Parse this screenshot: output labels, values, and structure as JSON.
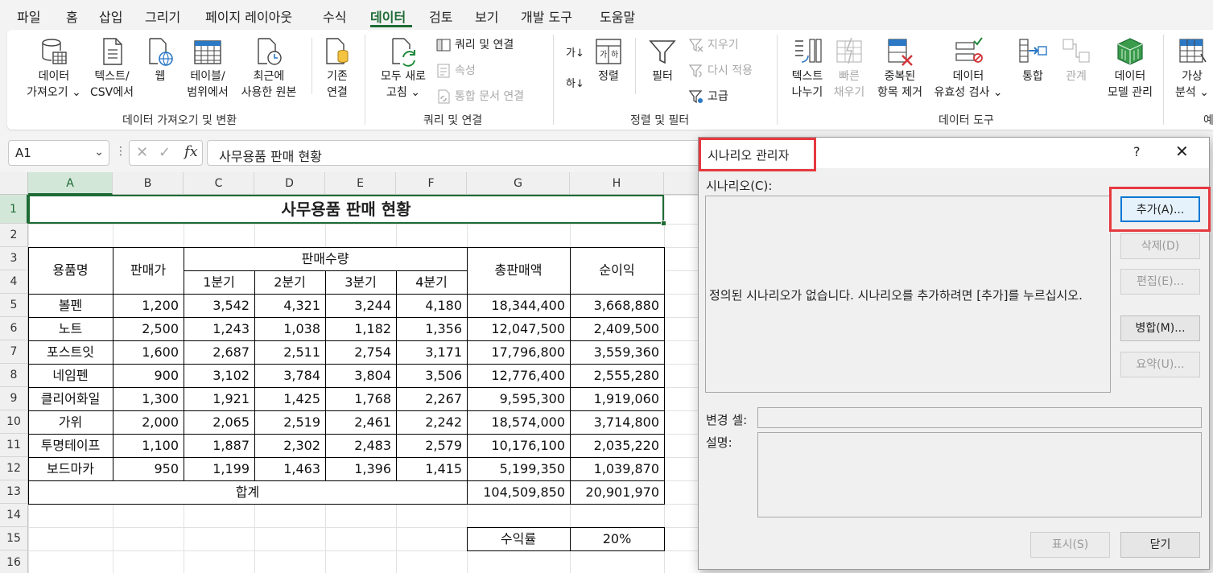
{
  "menu": {
    "items": [
      "파일",
      "홈",
      "삽입",
      "그리기",
      "페이지 레이아웃",
      "수식",
      "데이터",
      "검토",
      "보기",
      "개발 도구",
      "도움말"
    ],
    "active": "데이터"
  },
  "ribbon": {
    "get_data": {
      "line1": "데이터",
      "line2": "가져오기 ⌄"
    },
    "text_csv": {
      "line1": "텍스트/",
      "line2": "CSV에서"
    },
    "web": {
      "line1": "웹"
    },
    "from_table": {
      "line1": "테이블/",
      "line2": "범위에서"
    },
    "recent_sources": {
      "line1": "최근에",
      "line2": "사용한 원본"
    },
    "existing_conn": {
      "line1": "기존",
      "line2": "연결"
    },
    "group_get_transform": "데이터 가져오기 및 변환",
    "refresh_all": {
      "line1": "모두 새로",
      "line2": "고침 ⌄"
    },
    "queries_connections": "쿼리 및 연결",
    "properties": "속성",
    "edit_links": "통합 문서 연결",
    "group_queries": "쿼리 및 연결",
    "sort_asc": "가↓",
    "sort_desc": "하↓",
    "sort": {
      "line1": "정렬"
    },
    "filter": {
      "line1": "필터"
    },
    "clear": "지우기",
    "reapply": "다시 적용",
    "advanced": "고급",
    "group_sort_filter": "정렬 및 필터",
    "text_to_columns": {
      "line1": "텍스트",
      "line2": "나누기"
    },
    "flash_fill": {
      "line1": "빠른",
      "line2": "채우기"
    },
    "remove_duplicates": {
      "line1": "중복된",
      "line2": "항목 제거"
    },
    "data_validation": {
      "line1": "데이터",
      "line2": "유효성 검사 ⌄"
    },
    "consolidate": {
      "line1": "통합"
    },
    "relationships": {
      "line1": "관계"
    },
    "data_model": {
      "line1": "데이터",
      "line2": "모델 관리"
    },
    "group_data_tools": "데이터 도구",
    "what_if": {
      "line1": "가상",
      "line2": "분석 ⌄"
    },
    "group_forecast_partial": "예"
  },
  "formula_bar": {
    "name_box": "A1",
    "fx": "fx",
    "formula": "사무용품 판매 현황"
  },
  "sheet": {
    "columns": [
      "A",
      "B",
      "C",
      "D",
      "E",
      "F",
      "G",
      "H"
    ],
    "rows": [
      "1",
      "2",
      "3",
      "4",
      "5",
      "6",
      "7",
      "8",
      "9",
      "10",
      "11",
      "12",
      "13",
      "14",
      "15",
      "16"
    ],
    "title": "사무용품 판매 현황",
    "headers": {
      "item": "용품명",
      "price": "판매가",
      "qty": "판매수량",
      "q1": "1분기",
      "q2": "2분기",
      "q3": "3분기",
      "q4": "4분기",
      "total_sales": "총판매액",
      "net_profit": "순이익"
    },
    "data": [
      [
        "볼펜",
        "1,200",
        "3,542",
        "4,321",
        "3,244",
        "4,180",
        "18,344,400",
        "3,668,880"
      ],
      [
        "노트",
        "2,500",
        "1,243",
        "1,038",
        "1,182",
        "1,356",
        "12,047,500",
        "2,409,500"
      ],
      [
        "포스트잇",
        "1,600",
        "2,687",
        "2,511",
        "2,754",
        "3,171",
        "17,796,800",
        "3,559,360"
      ],
      [
        "네임펜",
        "900",
        "3,102",
        "3,784",
        "3,804",
        "3,506",
        "12,776,400",
        "2,555,280"
      ],
      [
        "클리어화일",
        "1,300",
        "1,921",
        "1,425",
        "1,768",
        "2,267",
        "9,595,300",
        "1,919,060"
      ],
      [
        "가위",
        "2,000",
        "2,065",
        "2,519",
        "2,461",
        "2,242",
        "18,574,000",
        "3,714,800"
      ],
      [
        "투명테이프",
        "1,100",
        "1,887",
        "2,302",
        "2,483",
        "2,579",
        "10,176,100",
        "2,035,220"
      ],
      [
        "보드마카",
        "950",
        "1,199",
        "1,463",
        "1,396",
        "1,415",
        "5,199,350",
        "1,039,870"
      ]
    ],
    "total_label": "합계",
    "total_sales": "104,509,850",
    "total_profit": "20,901,970",
    "margin_label": "수익률",
    "margin_value": "20%"
  },
  "dialog": {
    "title": "시나리오 관리자",
    "help": "?",
    "close": "✕",
    "scenarios_label": "시나리오(C):",
    "empty_message": "정의된 시나리오가 없습니다. 시나리오를 추가하려면 [추가]를 누르십시오.",
    "buttons": {
      "add": "추가(A)...",
      "delete": "삭제(D)",
      "edit": "편집(E)...",
      "merge": "병합(M)...",
      "summary": "요약(U)...",
      "show": "표시(S)",
      "close": "닫기"
    },
    "changing_cells_label": "변경 셀:",
    "comment_label": "설명:"
  },
  "colors": {
    "accent_green": "#1e6b35",
    "highlight_red": "#e5393f",
    "focus_blue": "#0078d4"
  }
}
